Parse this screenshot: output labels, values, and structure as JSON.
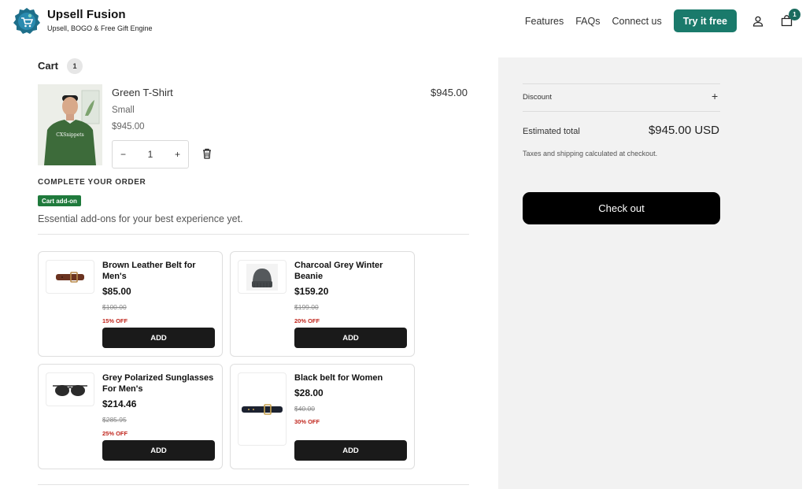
{
  "brand": {
    "name": "Upsell Fusion",
    "tagline": "Upsell, BOGO & Free Gift Engine",
    "accent": "#1a7a6b"
  },
  "nav": {
    "links": [
      "Features",
      "FAQs",
      "Connect us"
    ],
    "cta": "Try it free",
    "cart_count": "1"
  },
  "cart": {
    "title": "Cart",
    "count": "1",
    "item": {
      "name": "Green T-Shirt",
      "variant": "Small",
      "unit_price": "$945.00",
      "line_total": "$945.00",
      "quantity": "1",
      "image_text": "CXSnippets"
    }
  },
  "upsell": {
    "title": "COMPLETE YOUR ORDER",
    "badge": "Cart add-on",
    "description": "Essential add-ons for your best experience yet.",
    "products": [
      {
        "name": "Brown Leather Belt for Men's",
        "price": "$85.00",
        "compare": "$100.00",
        "off": "15% OFF",
        "add": "ADD"
      },
      {
        "name": "Charcoal Grey Winter Beanie",
        "price": "$159.20",
        "compare": "$199.00",
        "off": "20% OFF",
        "add": "ADD"
      },
      {
        "name": "Grey Polarized Sunglasses For Men's",
        "price": "$214.46",
        "compare": "$285.95",
        "off": "25% OFF",
        "add": "ADD"
      },
      {
        "name": "Black belt for Women",
        "price": "$28.00",
        "compare": "$40.00",
        "off": "30% OFF",
        "add": "ADD"
      }
    ]
  },
  "summary": {
    "discount_label": "Discount",
    "estimated_label": "Estimated total",
    "estimated_value": "$945.00 USD",
    "tax_note": "Taxes and shipping calculated at checkout.",
    "checkout": "Check out"
  }
}
